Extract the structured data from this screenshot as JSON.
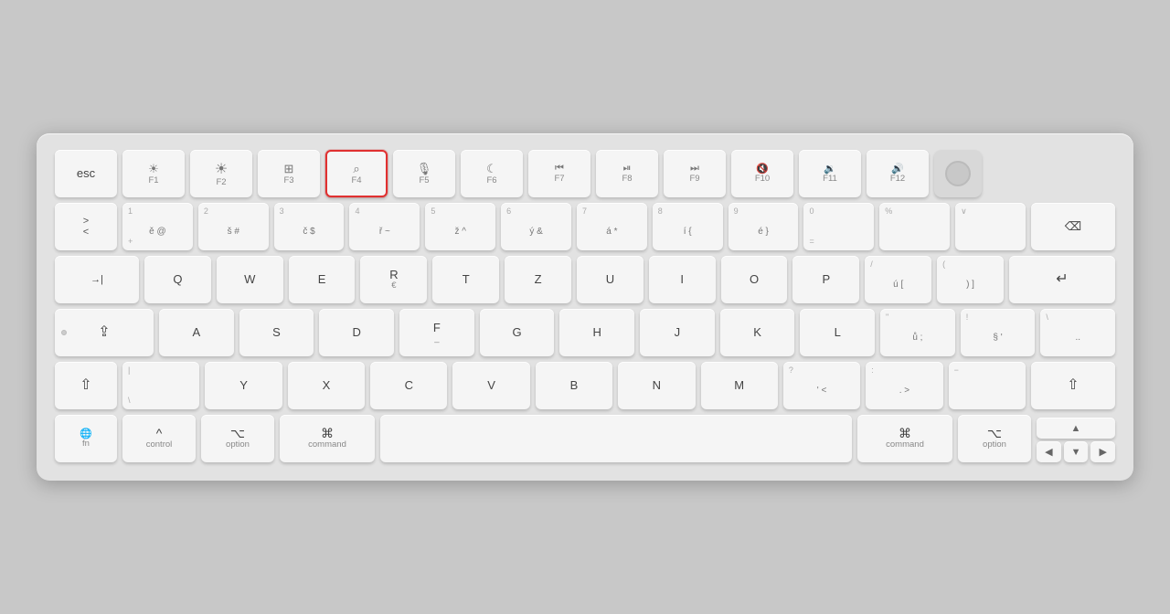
{
  "keyboard": {
    "rows": {
      "frow": [
        {
          "id": "esc",
          "label": "esc",
          "wide": true
        },
        {
          "id": "f1",
          "icon": "☀",
          "sub": "F1"
        },
        {
          "id": "f2",
          "icon": "☀",
          "sub": "F2",
          "icon_lg": true
        },
        {
          "id": "f3",
          "icon": "⊞",
          "sub": "F3"
        },
        {
          "id": "f4",
          "icon": "⌕",
          "sub": "F4",
          "highlighted": true
        },
        {
          "id": "f5",
          "icon": "🎙",
          "sub": "F5"
        },
        {
          "id": "f6",
          "icon": "☾",
          "sub": "F6"
        },
        {
          "id": "f7",
          "icon": "◀◀",
          "sub": "F7"
        },
        {
          "id": "f8",
          "icon": "▶⏸",
          "sub": "F8"
        },
        {
          "id": "f9",
          "icon": "▶▶",
          "sub": "F9"
        },
        {
          "id": "f10",
          "icon": "🔇",
          "sub": "F10"
        },
        {
          "id": "f11",
          "icon": "🔉",
          "sub": "F11"
        },
        {
          "id": "f12",
          "icon": "🔊",
          "sub": "F12"
        },
        {
          "id": "touchid",
          "label": ""
        }
      ],
      "numrow": [
        {
          "id": "tilde",
          "top": ">",
          "bot": "<"
        },
        {
          "id": "1",
          "top": "1",
          "bot": "+",
          "extra": "ě @"
        },
        {
          "id": "2",
          "top": "2",
          "bot": "",
          "extra": "š #"
        },
        {
          "id": "3",
          "top": "3",
          "bot": "",
          "extra": "č $"
        },
        {
          "id": "4",
          "top": "4",
          "bot": "",
          "extra": "ř ~"
        },
        {
          "id": "5",
          "top": "5",
          "bot": "",
          "extra": "ž ^"
        },
        {
          "id": "6",
          "top": "6",
          "bot": "",
          "extra": "ý &"
        },
        {
          "id": "7",
          "top": "7",
          "bot": "",
          "extra": "á *"
        },
        {
          "id": "8",
          "top": "8",
          "bot": "",
          "extra": "í {"
        },
        {
          "id": "9",
          "top": "9",
          "bot": "",
          "extra": "é }"
        },
        {
          "id": "0",
          "top": "0",
          "bot": "="
        },
        {
          "id": "percent",
          "top": "%",
          "bot": ""
        },
        {
          "id": "backtick",
          "top": "∨",
          "bot": ""
        },
        {
          "id": "backspace",
          "label": "⌫",
          "wide": true
        }
      ],
      "qrow": [
        {
          "id": "tab",
          "label": "→|",
          "wide": true
        },
        {
          "id": "q",
          "label": "Q"
        },
        {
          "id": "w",
          "label": "W"
        },
        {
          "id": "e",
          "label": "E"
        },
        {
          "id": "r",
          "label": "R",
          "sub": "€"
        },
        {
          "id": "t",
          "label": "T"
        },
        {
          "id": "z",
          "label": "Z"
        },
        {
          "id": "u",
          "label": "U"
        },
        {
          "id": "i",
          "label": "I"
        },
        {
          "id": "o",
          "label": "O"
        },
        {
          "id": "p",
          "label": "P"
        },
        {
          "id": "slash",
          "top": "/",
          "bot": "ú ["
        },
        {
          "id": "paren",
          "top": "(",
          "bot": ") ]"
        },
        {
          "id": "return",
          "label": "↵",
          "wide": true
        }
      ],
      "arow": [
        {
          "id": "caps",
          "label": "⇪",
          "wide": true,
          "dot": true
        },
        {
          "id": "a",
          "label": "A"
        },
        {
          "id": "s",
          "label": "S"
        },
        {
          "id": "d",
          "label": "D"
        },
        {
          "id": "f",
          "label": "F",
          "sub": "_"
        },
        {
          "id": "g",
          "label": "G"
        },
        {
          "id": "h",
          "label": "H"
        },
        {
          "id": "j",
          "label": "J"
        },
        {
          "id": "k",
          "label": "K"
        },
        {
          "id": "l",
          "label": "L"
        },
        {
          "id": "semicolon",
          "top": "\"",
          "bot": "ů ;"
        },
        {
          "id": "excl",
          "top": "!",
          "bot": "§ '"
        },
        {
          "id": "dotdot",
          "top": "\\",
          "bot": ".."
        }
      ],
      "zrow": [
        {
          "id": "lshift",
          "label": "⇧",
          "wide": true
        },
        {
          "id": "pipe",
          "top": "|",
          "bot": "\\"
        },
        {
          "id": "y",
          "label": "Y"
        },
        {
          "id": "x",
          "label": "X"
        },
        {
          "id": "c",
          "label": "C"
        },
        {
          "id": "v",
          "label": "V"
        },
        {
          "id": "b",
          "label": "B"
        },
        {
          "id": "n",
          "label": "N"
        },
        {
          "id": "m",
          "label": "M"
        },
        {
          "id": "quest",
          "top": "?",
          "bot": "' <"
        },
        {
          "id": "colon",
          "top": ":",
          "bot": ". >"
        },
        {
          "id": "minus",
          "top": "−",
          "bot": ""
        },
        {
          "id": "rshift",
          "label": "⇧",
          "wide": true
        }
      ],
      "bottomrow": [
        {
          "id": "fn",
          "main": "fn",
          "sub": "🌐"
        },
        {
          "id": "control",
          "main": "^",
          "sub": "control"
        },
        {
          "id": "option-l",
          "main": "⌥",
          "sub": "option"
        },
        {
          "id": "command-l",
          "main": "⌘",
          "sub": "command"
        },
        {
          "id": "space",
          "label": ""
        },
        {
          "id": "command-r",
          "main": "⌘",
          "sub": "command"
        },
        {
          "id": "option-r",
          "main": "⌥",
          "sub": "option"
        },
        {
          "id": "arrows",
          "keys": [
            "▲",
            "◀",
            "▼",
            "▶"
          ]
        }
      ]
    }
  }
}
